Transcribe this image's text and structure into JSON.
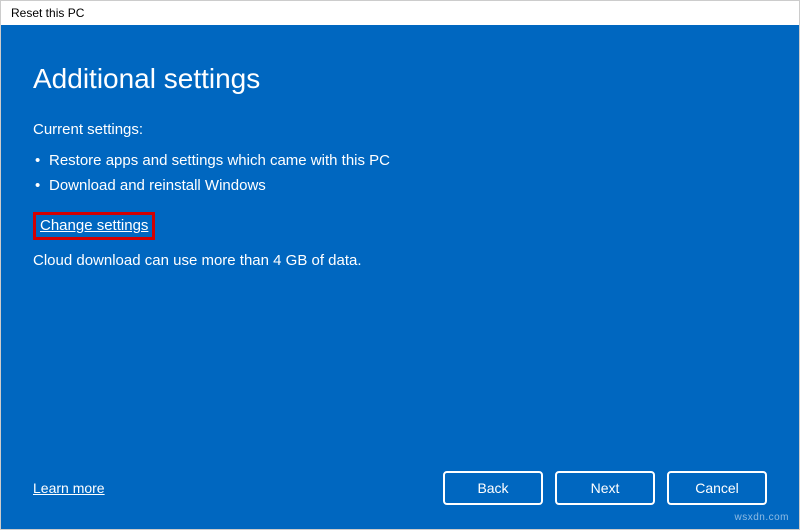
{
  "window": {
    "title": "Reset this PC"
  },
  "main": {
    "heading": "Additional settings",
    "current_label": "Current settings:",
    "bullets": [
      "Restore apps and settings which came with this PC",
      "Download and reinstall Windows"
    ],
    "change_link": "Change settings",
    "note": "Cloud download can use more than 4 GB of data."
  },
  "footer": {
    "learn_more": "Learn more",
    "back": "Back",
    "next": "Next",
    "cancel": "Cancel"
  },
  "watermark": "wsxdn.com"
}
